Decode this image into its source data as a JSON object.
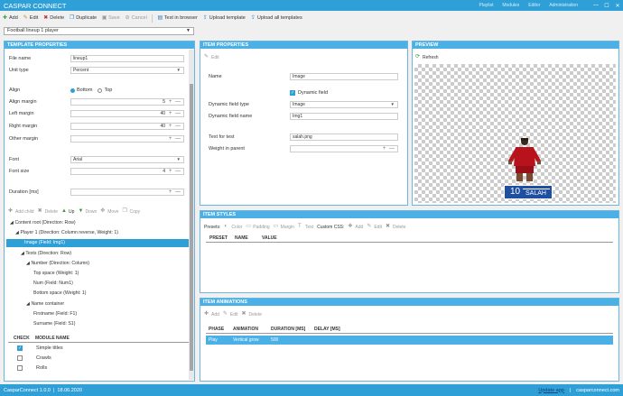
{
  "window": {
    "title": "CASPAR CONNECT",
    "nav": [
      "Playlist",
      "Modules",
      "Editor",
      "Administration"
    ],
    "controls": [
      "—",
      "☐",
      "✕"
    ]
  },
  "toolbar": {
    "add": "Add",
    "edit": "Edit",
    "delete": "Delete",
    "duplicate": "Duplicate",
    "save": "Save",
    "cancel": "Cancel",
    "test": "Test in browser",
    "upload": "Upload template",
    "upload_all": "Upload all templates"
  },
  "lineup": {
    "selected": "Football lineup 1 player"
  },
  "template_props": {
    "header": "TEMPLATE PROPERTIES",
    "file_name_label": "File name",
    "file_name": "lineup1",
    "unit_type_label": "Unit type",
    "unit_type": "Percent",
    "align_label": "Align",
    "align_bottom": "Bottom",
    "align_top": "Top",
    "align_margin_label": "Align margin",
    "align_margin": "5",
    "left_margin_label": "Left margin",
    "left_margin": "40",
    "right_margin_label": "Right margin",
    "right_margin": "40",
    "other_margin_label": "Other margin",
    "other_margin": "",
    "font_label": "Font",
    "font": "Arial",
    "font_size_label": "Font size",
    "font_size": "4",
    "duration_label": "Duration [ms]",
    "duration": ""
  },
  "tree_toolbar": {
    "add_child": "Add child",
    "delete": "Delete",
    "up": "Up",
    "down": "Down",
    "move": "Move",
    "copy": "Copy"
  },
  "tree": [
    "Content root (Direction: Row)",
    "Player 1 (Direction: Column reverse, Weight: 1)",
    "Image (Field: Img1)",
    "Texts (Direction: Row)",
    "Number (Direction: Column)",
    "Top space (Weight: 1)",
    "Num (Field: Num1)",
    "Bottom space (Weight: 1)",
    "Name container",
    "Firstname (Field: F1)",
    "Surname (Field: S1)"
  ],
  "modules": {
    "headers": [
      "CHECK",
      "MODULE NAME"
    ],
    "rows": [
      {
        "checked": true,
        "name": "Simple titles"
      },
      {
        "checked": false,
        "name": "Crawls"
      },
      {
        "checked": false,
        "name": "Rolls"
      }
    ]
  },
  "item_props": {
    "header": "ITEM PROPERTIES",
    "edit": "Edit",
    "name_label": "Name",
    "name": "Image",
    "dynamic_label": "Dynamic field",
    "type_label": "Dynamic field type",
    "type": "Image",
    "field_name_label": "Dynamic field name",
    "field_name": "Img1",
    "test_label": "Text for test",
    "test": "salah.png",
    "weight_label": "Weight in parent",
    "weight": ""
  },
  "preview": {
    "header": "PREVIEW",
    "refresh": "Refresh",
    "number": "10",
    "player_name": "SALAH"
  },
  "item_styles": {
    "header": "ITEM STYLES",
    "presets": "Presets:",
    "color": "Color",
    "padding": "Padding",
    "margin": "Margin",
    "text": "Text",
    "custom_css": "Custom CSS:",
    "add": "Add",
    "edit": "Edit",
    "delete": "Delete",
    "cols": [
      "PRESET",
      "NAME",
      "VALUE"
    ]
  },
  "item_anim": {
    "header": "ITEM ANIMATIONS",
    "add": "Add",
    "edit": "Edit",
    "delete": "Delete",
    "cols": [
      "PHASE",
      "ANIMATION",
      "DURATION [MS]",
      "DELAY [MS]"
    ],
    "row": [
      "Play",
      "Vertical grow",
      "500",
      ""
    ]
  },
  "status": {
    "version": "CasparConnect 1.0.0",
    "date": "18.06.2020",
    "update": "Update app",
    "site": "casparconnect.com"
  },
  "colors": {
    "accent": "#2f9fd8",
    "header": "#4ab0e6",
    "shirt": "#b8121c",
    "lower_third": "#1e4fa0"
  }
}
